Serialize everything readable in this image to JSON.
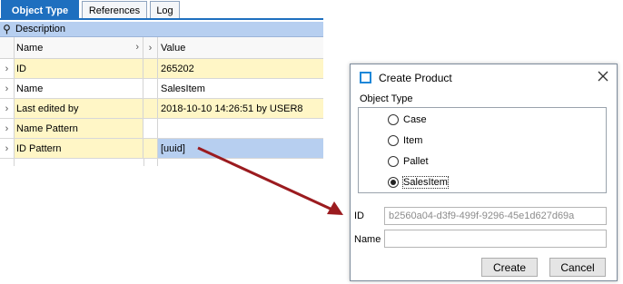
{
  "tabs": [
    "Object Type",
    "References",
    "Log"
  ],
  "grid": {
    "description_label": "Description",
    "columns": {
      "name": "Name",
      "value": "Value"
    },
    "rows": [
      {
        "name": "ID",
        "value": "265202"
      },
      {
        "name": "Name",
        "value": "SalesItem"
      },
      {
        "name": "Last edited by",
        "value": "2018-10-10 14:26:51 by USER8"
      },
      {
        "name": "Name Pattern",
        "value": ""
      },
      {
        "name": "ID Pattern",
        "value": "[uuid]"
      }
    ]
  },
  "dialog": {
    "title": "Create Product",
    "group_label": "Object Type",
    "options": [
      "Case",
      "Item",
      "Pallet",
      "SalesItem"
    ],
    "selected_option": "SalesItem",
    "id_label": "ID",
    "id_value": "b2560a04-d3f9-499f-9296-45e1d627d69a",
    "name_label": "Name",
    "name_value": "",
    "create_label": "Create",
    "cancel_label": "Cancel"
  },
  "colors": {
    "tab_active": "#1e6fbf",
    "row_highlight": "#fff6c6",
    "selection": "#b7cff0",
    "arrow": "#9b1b1f"
  },
  "icons": [
    "pin-icon",
    "chevron-right-icon",
    "app-window-icon",
    "close-icon"
  ]
}
